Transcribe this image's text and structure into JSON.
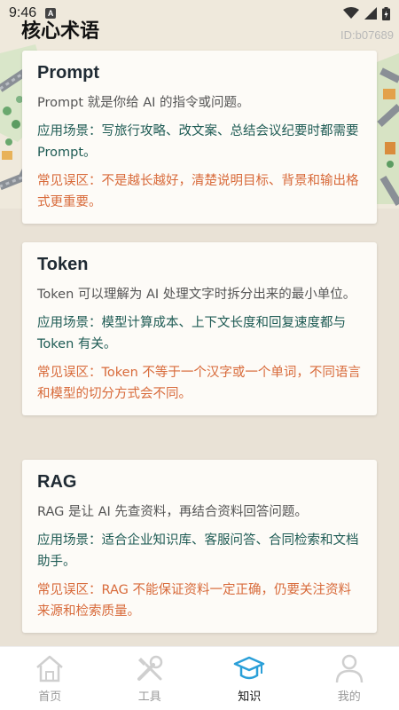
{
  "status_bar": {
    "time": "9:46",
    "notification_badge": "A"
  },
  "header": {
    "title": "核心术语",
    "id_text": "ID:b07689"
  },
  "cards": [
    {
      "term": "Prompt",
      "definition": "Prompt 就是你给 AI 的指令或问题。",
      "use_case": "应用场景：写旅行攻略、改文案、总结会议纪要时都需要 Prompt。",
      "misconception": "常见误区：不是越长越好，清楚说明目标、背景和输出格式更重要。"
    },
    {
      "term": "Token",
      "definition": "Token 可以理解为 AI 处理文字时拆分出来的最小单位。",
      "use_case": "应用场景：模型计算成本、上下文长度和回复速度都与 Token 有关。",
      "misconception": "常见误区：Token 不等于一个汉字或一个单词，不同语言和模型的切分方式会不同。"
    },
    {
      "term": "RAG",
      "definition": "RAG 是让 AI 先查资料，再结合资料回答问题。",
      "use_case": "应用场景：适合企业知识库、客服问答、合同检索和文档助手。",
      "misconception": "常见误区：RAG 不能保证资料一定正确，仍要关注资料来源和检索质量。"
    }
  ],
  "tabs": [
    {
      "label": "首页",
      "icon": "home-icon",
      "active": false
    },
    {
      "label": "工具",
      "icon": "tools-icon",
      "active": false
    },
    {
      "label": "知识",
      "icon": "graduation-cap-icon",
      "active": true
    },
    {
      "label": "我的",
      "icon": "user-icon",
      "active": false
    }
  ],
  "colors": {
    "use_case_text": "#1e5b54",
    "misconception_text": "#d86a3a",
    "active_tab_icon": "#2a9fd8",
    "inactive_tab_icon": "#cfcfcf"
  }
}
